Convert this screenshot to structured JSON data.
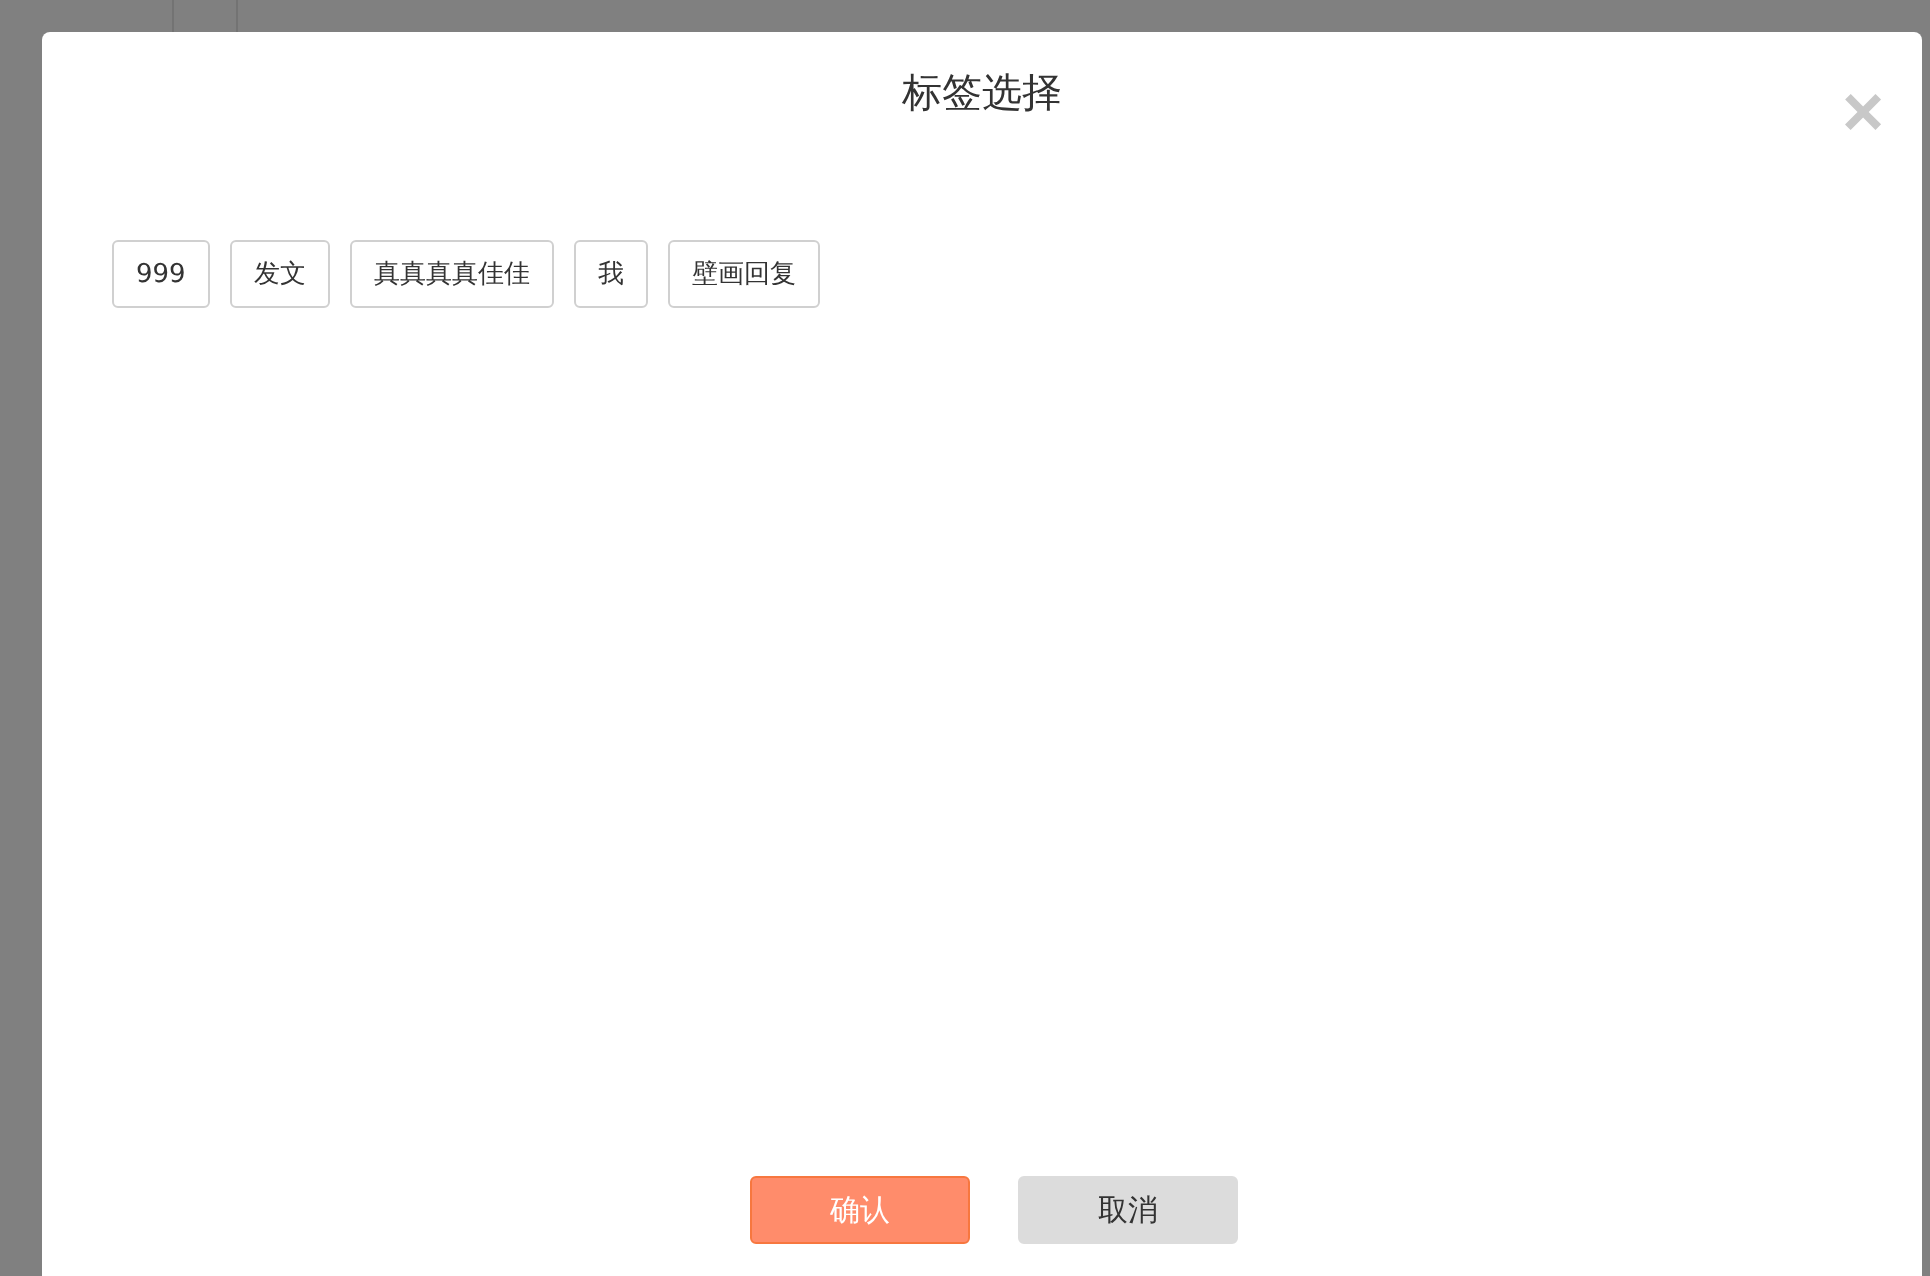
{
  "dialog": {
    "title": "标签选择",
    "close": "×",
    "tags": [
      {
        "label": "999"
      },
      {
        "label": "发文"
      },
      {
        "label": "真真真真佳佳"
      },
      {
        "label": "我"
      },
      {
        "label": "壁画回复"
      }
    ],
    "buttons": [
      {
        "label": "确认",
        "kind": "primary"
      },
      {
        "label": "取消",
        "kind": "secondary"
      }
    ]
  }
}
